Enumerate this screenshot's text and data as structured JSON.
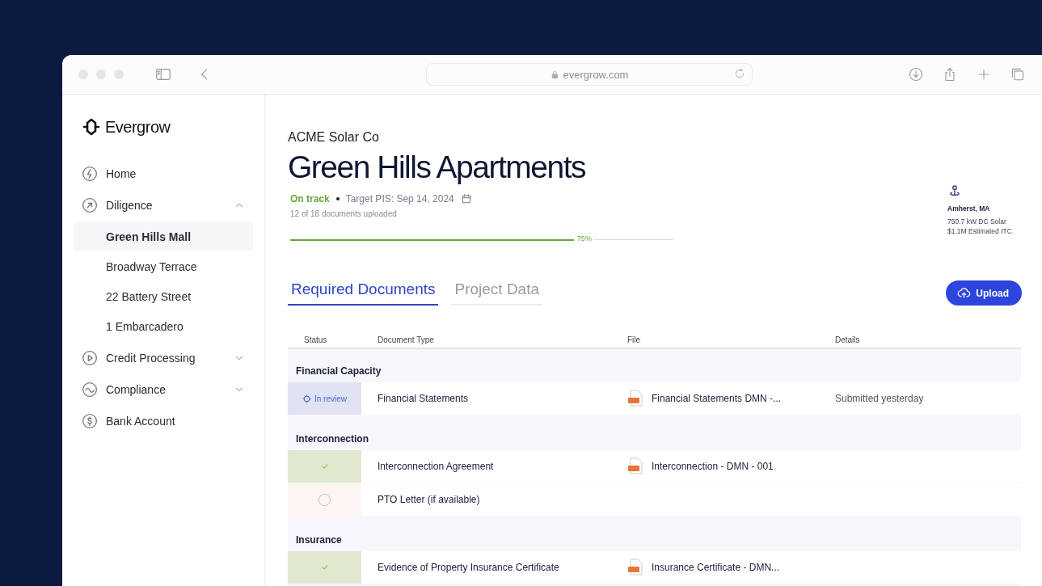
{
  "browser": {
    "url": "evergrow.com"
  },
  "sidebar": {
    "logo": "Evergrow",
    "items": [
      {
        "label": "Home",
        "kind": "home"
      },
      {
        "label": "Diligence",
        "kind": "diligence",
        "expanded": true,
        "children": [
          {
            "label": "Green Hills Mall",
            "selected": true
          },
          {
            "label": "Broadway Terrace",
            "selected": false
          },
          {
            "label": "22 Battery Street",
            "selected": false
          },
          {
            "label": "1 Embarcadero",
            "selected": false
          }
        ]
      },
      {
        "label": "Credit Processing",
        "kind": "credit",
        "expanded": false
      },
      {
        "label": "Compliance",
        "kind": "compliance",
        "expanded": false
      },
      {
        "label": "Bank Account",
        "kind": "bank"
      }
    ]
  },
  "project": {
    "company": "ACME Solar Co",
    "title": "Green Hills Apartments",
    "status": "On track",
    "target": "Target PIS: Sep 14, 2024",
    "uploaded": "12 of 18 documents uploaded",
    "progress": {
      "level": 0.74,
      "reading": "75%"
    }
  },
  "location": {
    "city": "Amherst, MA",
    "capacity": "750.7 kW DC Solar",
    "itc": "$1.1M Estimated ITC"
  },
  "tabs": [
    {
      "label": "Required Documents",
      "selected": true
    },
    {
      "label": "Project Data",
      "selected": false
    }
  ],
  "upload_button": "Upload",
  "table": {
    "columns": [
      "Status",
      "Document Type",
      "File",
      "Details"
    ],
    "groups": [
      {
        "name": "Financial Capacity",
        "rows": [
          {
            "kind": "review",
            "status_label": "In review",
            "type": "Financial Statements",
            "file": "Financial Statements DMN -...",
            "details": "Submitted yesterday"
          }
        ]
      },
      {
        "name": "Interconnection",
        "rows": [
          {
            "kind": "done",
            "type": "Interconnection Agreement",
            "file": "Interconnection - DMN - 001"
          },
          {
            "kind": "pending",
            "type": "PTO Letter (if available)"
          }
        ]
      },
      {
        "name": "Insurance",
        "rows": [
          {
            "kind": "done",
            "type": "Evidence of Property Insurance Certificate",
            "file": "Insurance Certificate - DMN..."
          }
        ]
      }
    ]
  }
}
